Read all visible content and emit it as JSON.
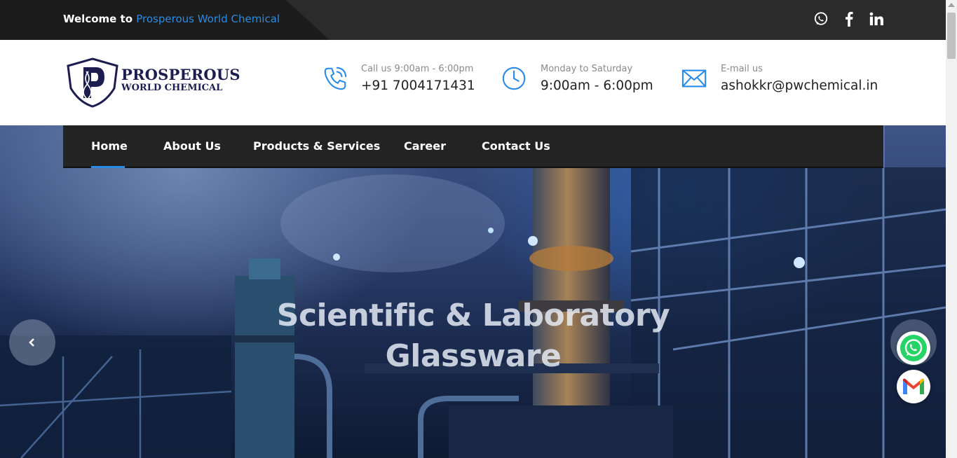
{
  "topbar": {
    "welcome_prefix": "Welcome to",
    "brand_name": "Prosperous World Chemical",
    "social": [
      "whatsapp-icon",
      "facebook-icon",
      "linkedin-icon"
    ]
  },
  "logo": {
    "line1": "PROSPEROUS",
    "line2": "WORLD CHEMICAL",
    "mark": "P"
  },
  "contact": {
    "phone": {
      "label": "Call us 9:00am - 6:00pm",
      "value": "+91 7004171431",
      "icon": "phone-icon"
    },
    "hours": {
      "label": "Monday to Saturday",
      "value": "9:00am - 6:00pm",
      "icon": "clock-icon"
    },
    "email": {
      "label": "E-mail us",
      "value": "ashokkr@pwchemical.in",
      "icon": "mail-icon"
    }
  },
  "nav": {
    "items": [
      {
        "label": "Home",
        "active": true
      },
      {
        "label": "About Us"
      },
      {
        "label": "Products & Services"
      },
      {
        "label": "Career"
      },
      {
        "label": "Contact Us"
      }
    ]
  },
  "hero": {
    "title_line1": "Scientific & Laboratory",
    "title_line2": "Glassware"
  },
  "colors": {
    "accent": "#2a8be6",
    "topbar": "#2b2b2b",
    "nav": "#232323",
    "logo": "#1d1d4f",
    "whatsapp": "#25d366"
  }
}
